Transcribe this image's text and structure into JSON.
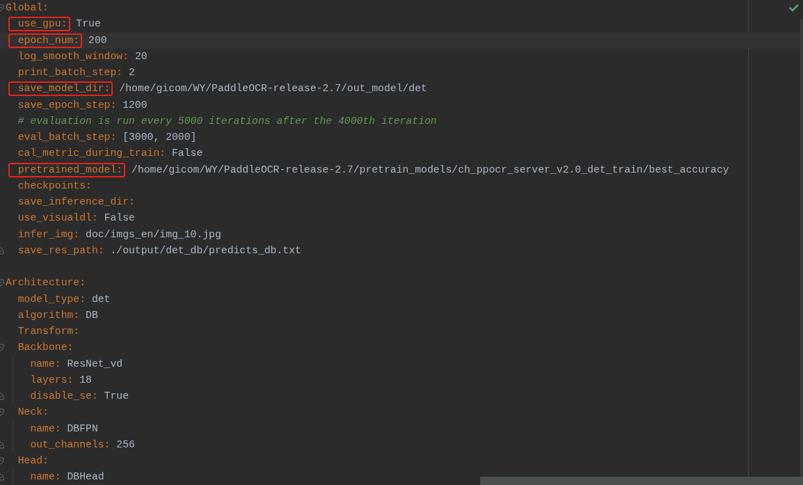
{
  "editor": {
    "status_ok": true,
    "lines": [
      {
        "kind": "key",
        "key": "Global:",
        "children": [
          {
            "kind": "key",
            "key": "use_gpu:",
            "value": "True",
            "marked": true,
            "current": false
          },
          {
            "kind": "key",
            "key": "epoch_num:",
            "value": "200",
            "marked": true,
            "current": true
          },
          {
            "kind": "key",
            "key": "log_smooth_window:",
            "value": "20",
            "marked": false,
            "current": false
          },
          {
            "kind": "key",
            "key": "print_batch_step:",
            "value": "2",
            "marked": false,
            "current": false
          },
          {
            "kind": "key",
            "key": "save_model_dir:",
            "value": "/home/gicom/WY/PaddleOCR-release-2.7/out_model/det",
            "marked": true,
            "current": false
          },
          {
            "kind": "key",
            "key": "save_epoch_step:",
            "value": "1200",
            "marked": false,
            "current": false
          },
          {
            "kind": "comment",
            "text": "# evaluation is run every 5000 iterations after the 4000th iteration"
          },
          {
            "kind": "key",
            "key": "eval_batch_step:",
            "value": "[3000, 2000]",
            "marked": false,
            "current": false
          },
          {
            "kind": "key",
            "key": "cal_metric_during_train:",
            "value": "False",
            "marked": false,
            "current": false
          },
          {
            "kind": "key",
            "key": "pretrained_model:",
            "value": "/home/gicom/WY/PaddleOCR-release-2.7/pretrain_models/ch_ppocr_server_v2.0_det_train/best_accuracy",
            "marked": true,
            "current": false
          },
          {
            "kind": "key",
            "key": "checkpoints:",
            "marked": false,
            "current": false
          },
          {
            "kind": "key",
            "key": "save_inference_dir:",
            "marked": false,
            "current": false
          },
          {
            "kind": "key",
            "key": "use_visualdl:",
            "value": "False",
            "marked": false,
            "current": false
          },
          {
            "kind": "key",
            "key": "infer_img:",
            "value": "doc/imgs_en/img_10.jpg",
            "marked": false,
            "current": false
          },
          {
            "kind": "key",
            "key": "save_res_path:",
            "value": "./output/det_db/predicts_db.txt",
            "marked": false,
            "current": false
          }
        ]
      },
      {
        "kind": "blank"
      },
      {
        "kind": "key",
        "key": "Architecture:",
        "children": [
          {
            "kind": "key",
            "key": "model_type:",
            "value": "det",
            "marked": false,
            "current": false
          },
          {
            "kind": "key",
            "key": "algorithm:",
            "value": "DB",
            "marked": false,
            "current": false
          },
          {
            "kind": "key",
            "key": "Transform:",
            "marked": false,
            "current": false
          },
          {
            "kind": "key",
            "key": "Backbone:",
            "marked": false,
            "current": false,
            "children": [
              {
                "kind": "key",
                "key": "name:",
                "value": "ResNet_vd",
                "marked": false,
                "current": false
              },
              {
                "kind": "key",
                "key": "layers:",
                "value": "18",
                "marked": false,
                "current": false
              },
              {
                "kind": "key",
                "key": "disable_se:",
                "value": "True",
                "marked": false,
                "current": false
              }
            ]
          },
          {
            "kind": "key",
            "key": "Neck:",
            "marked": false,
            "current": false,
            "children": [
              {
                "kind": "key",
                "key": "name:",
                "value": "DBFPN",
                "marked": false,
                "current": false
              },
              {
                "kind": "key",
                "key": "out_channels:",
                "value": "256",
                "marked": false,
                "current": false
              }
            ]
          },
          {
            "kind": "key",
            "key": "Head:",
            "marked": false,
            "current": false,
            "children": [
              {
                "kind": "key",
                "key": "name:",
                "value": "DBHead",
                "marked": false,
                "current": false
              }
            ]
          }
        ]
      }
    ]
  }
}
